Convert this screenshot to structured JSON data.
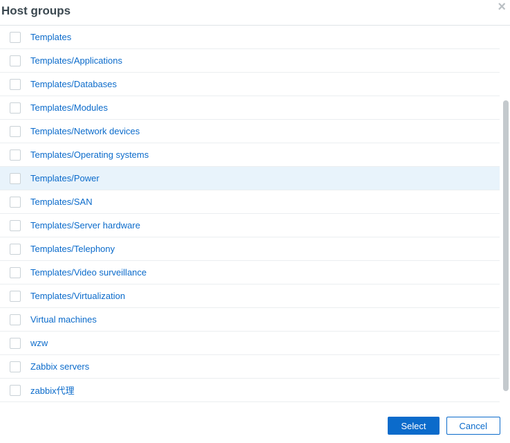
{
  "dialog": {
    "title": "Host groups"
  },
  "list": {
    "highlighted_index": 6,
    "items": [
      {
        "label": "Templates"
      },
      {
        "label": "Templates/Applications"
      },
      {
        "label": "Templates/Databases"
      },
      {
        "label": "Templates/Modules"
      },
      {
        "label": "Templates/Network devices"
      },
      {
        "label": "Templates/Operating systems"
      },
      {
        "label": "Templates/Power"
      },
      {
        "label": "Templates/SAN"
      },
      {
        "label": "Templates/Server hardware"
      },
      {
        "label": "Templates/Telephony"
      },
      {
        "label": "Templates/Video surveillance"
      },
      {
        "label": "Templates/Virtualization"
      },
      {
        "label": "Virtual machines"
      },
      {
        "label": "wzw"
      },
      {
        "label": "Zabbix servers"
      },
      {
        "label": "zabbix代理"
      }
    ]
  },
  "footer": {
    "select_label": "Select",
    "cancel_label": "Cancel"
  },
  "icons": {
    "close": "×"
  }
}
